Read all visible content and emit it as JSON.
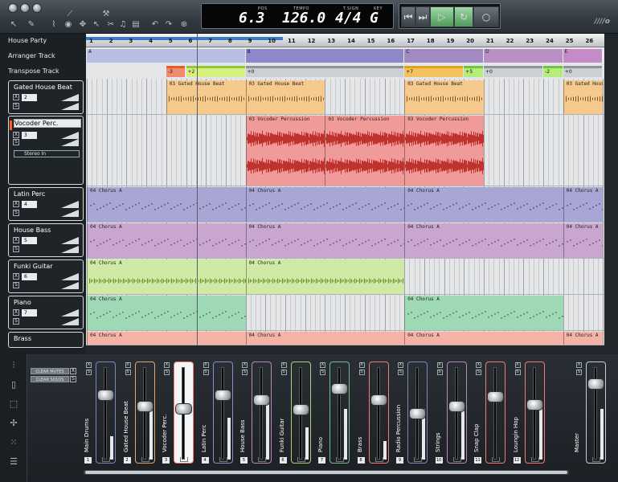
{
  "toolbar": {
    "icons": [
      "window-close",
      "window-minimize",
      "window-zoom",
      "pointer-tool",
      "draw-tool",
      "split-tool",
      "erase-tool",
      "mute-tool",
      "listen-tool",
      "settings-tool",
      "arrange-tool",
      "undo",
      "redo",
      "zoom-in",
      "zoom-out"
    ]
  },
  "lcd": {
    "pos_label": "POS",
    "pos_value": "6.3",
    "tempo_label": "TEMPO",
    "tempo_value": "126.0",
    "tsign_label": "T.SIGN",
    "tsign_value": "4/4",
    "key_label": "KEY",
    "key_value": "G"
  },
  "transport": {
    "rewind": "⏮",
    "forward": "⏭",
    "play": "▷",
    "loop": "↻",
    "record": "○"
  },
  "logo": "////o",
  "tracks_header": {
    "song": "House Party",
    "arranger": "Arranger Track",
    "transpose": "Transpose Track"
  },
  "tracks": [
    {
      "name": "Gated House Beat",
      "channel": "2"
    },
    {
      "name": "Vocoder Perc.",
      "channel": "3",
      "input": "Stereo In"
    },
    {
      "name": "Latin Perc",
      "channel": "4"
    },
    {
      "name": "House Bass",
      "channel": "5"
    },
    {
      "name": "Funki Guitar",
      "channel": "6"
    },
    {
      "name": "Piano",
      "channel": "7"
    },
    {
      "name": "Brass",
      "channel": ""
    }
  ],
  "ruler": [
    "1",
    "2",
    "3",
    "4",
    "5",
    "6",
    "7",
    "8",
    "9",
    "10",
    "11",
    "12",
    "13",
    "14",
    "15",
    "16",
    "17",
    "18",
    "19",
    "20",
    "21",
    "22",
    "23",
    "24",
    "25",
    "26"
  ],
  "sections": [
    "A",
    "B",
    "C",
    "D",
    "E"
  ],
  "transpose": [
    "-3",
    "+2",
    "+0",
    "+7",
    "+5",
    "+0",
    "-2",
    "+0"
  ],
  "clips": {
    "gated": "03 Gated House Beat",
    "vocoder": "03 Vocoder Percussion",
    "chorus": "04 Chorus A"
  },
  "mixer": {
    "clear_mutes": "CLEAR MUTES",
    "clear_solos": "CLEAR SOLOS",
    "strips": [
      {
        "name": "Main Drums",
        "num": "1",
        "color": "#7c89b8",
        "level": 0.72,
        "meter": 0.25
      },
      {
        "name": "Gated House Beat",
        "num": "2",
        "color": "#e9a36c",
        "level": 0.58,
        "meter": 0.55
      },
      {
        "name": "Vocoder Perc.",
        "num": "3",
        "color": "#f07e70",
        "level": 0.55,
        "meter": 0.0,
        "selected": true
      },
      {
        "name": "Latin Perc",
        "num": "4",
        "color": "#8d8cc6",
        "level": 0.72,
        "meter": 0.45
      },
      {
        "name": "House Bass",
        "num": "5",
        "color": "#b48bbb",
        "level": 0.66,
        "meter": 0.62
      },
      {
        "name": "Funki Guitar",
        "num": "6",
        "color": "#a8d37b",
        "level": 0.54,
        "meter": 0.35
      },
      {
        "name": "Piano",
        "num": "7",
        "color": "#6bc08f",
        "level": 0.8,
        "meter": 0.55
      },
      {
        "name": "Brass",
        "num": "8",
        "color": "#f07e70",
        "level": 0.66,
        "meter": 0.2
      },
      {
        "name": "Radio Percussion",
        "num": "9",
        "color": "#7c89b8",
        "level": 0.5,
        "meter": 0.55
      },
      {
        "name": "Strings",
        "num": "10",
        "color": "#b48bbb",
        "level": 0.58,
        "meter": 0.55
      },
      {
        "name": "Snap Clap",
        "num": "11",
        "color": "#f07e70",
        "level": 0.7,
        "meter": 0.0
      },
      {
        "name": "Loungin Hop",
        "num": "12",
        "color": "#f07e70",
        "level": 0.6,
        "meter": 0.55
      },
      {
        "name": "Master",
        "num": "",
        "color": "#c7cdd2",
        "level": 0.86,
        "meter": 0.55
      }
    ]
  }
}
